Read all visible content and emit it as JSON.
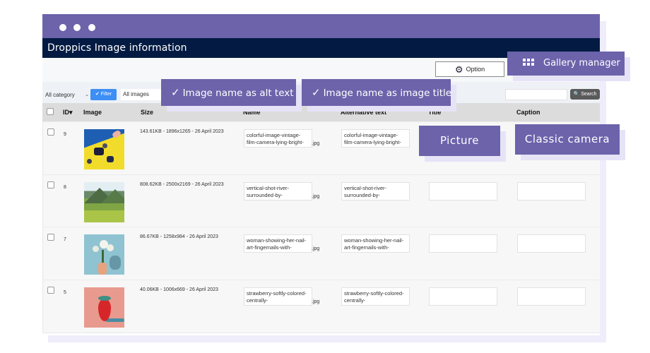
{
  "window": {
    "title": "Droppics Image information",
    "traffic_lights": [
      "dot",
      "dot",
      "dot"
    ]
  },
  "toolbar": {
    "option_label": "Option",
    "option_icon": "gear-icon"
  },
  "filters": {
    "category_select": "All category",
    "filter_button": "✔ Filter",
    "images_select": "All images",
    "search_value": "",
    "search_button": "🔍 Search"
  },
  "table": {
    "columns": [
      "",
      "ID▾",
      "Image",
      "Size",
      "Name",
      "Alternative text",
      "Title",
      "Caption"
    ],
    "rows": [
      {
        "id": "9",
        "thumbnail": "camera-on-yellow",
        "size": "143.61KB - 1896x1265 - 26 April 2023",
        "name": "colorful-image-vintage-film-camera-lying-bright-",
        "ext": ".jpg",
        "alt": "colorful-image-vintage-film-camera-lying-bright-",
        "title": "",
        "caption": ""
      },
      {
        "id": "8",
        "thumbnail": "green-valley-river",
        "size": "808.62KB - 2500x2169 - 26 April 2023",
        "name": "vertical-shot-river-surrounded-by-",
        "ext": ".jpg",
        "alt": "vertical-shot-river-surrounded-by-",
        "title": "",
        "caption": ""
      },
      {
        "id": "7",
        "thumbnail": "flowers-in-hand",
        "size": "86.67KB - 1258x984 - 26 April 2023",
        "name": "woman-showing-her-nail-art-fingernails-with-",
        "ext": ".jpg",
        "alt": "woman-showing-her-nail-art-fingernails-with-",
        "title": "",
        "caption": ""
      },
      {
        "id": "5",
        "thumbnail": "strawberry-on-pink",
        "size": "40.06KB - 1006x669 - 26 April 2023",
        "name": "strawberry-softly-colored-centrally-",
        "ext": ".jpg",
        "alt": "strawberry-softly-colored-centrally-",
        "title": "",
        "caption": ""
      }
    ]
  },
  "callouts": {
    "gallery_manager": "Gallery manager",
    "alt_text": "Image name as alt text",
    "image_title": "Image name as image title",
    "picture": "Picture",
    "classic_camera": "Classic camera",
    "check_glyph": "✓"
  },
  "colors": {
    "accent_purple": "#6c63ab",
    "app_bar_navy": "#031b43",
    "filter_blue": "#3d8ef5",
    "search_gray": "#5a5a5a"
  }
}
